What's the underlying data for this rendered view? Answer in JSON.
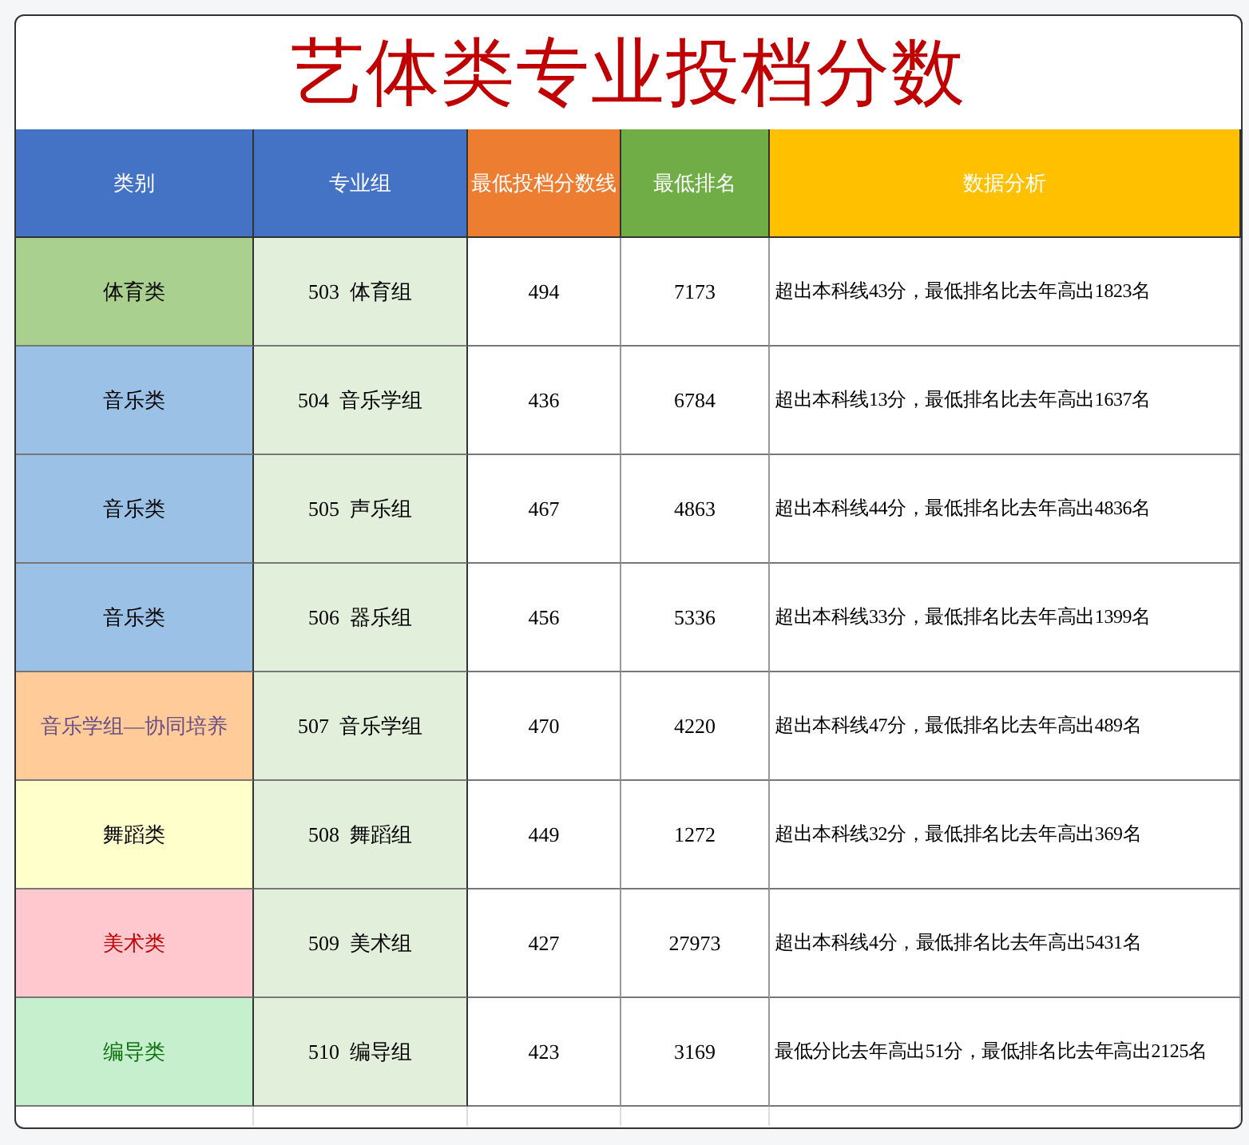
{
  "title": "艺体类专业投档分数",
  "columns": [
    {
      "label": "类别",
      "color": "#4472c4"
    },
    {
      "label": "专业组",
      "color": "#4472c4"
    },
    {
      "label": "最低投档分数线",
      "color": "#ed7d31"
    },
    {
      "label": "最低排名",
      "color": "#70ad47"
    },
    {
      "label": "数据分析",
      "color": "#ffc000"
    }
  ],
  "rows": [
    {
      "category": "体育类",
      "kind": "neutral",
      "color": "#a9d08e",
      "group": "503  体育组",
      "score": "494",
      "rank": "7173",
      "analysis": "超出本科线43分，最低排名比去年高出1823名"
    },
    {
      "category": "音乐类",
      "kind": "neutral",
      "color": "#9bc2e6",
      "group": "504  音乐学组",
      "score": "436",
      "rank": "6784",
      "analysis": "超出本科线13分，最低排名比去年高出1637名"
    },
    {
      "category": "音乐类",
      "kind": "neutral",
      "color": "#9bc2e6",
      "group": "505  声乐组",
      "score": "467",
      "rank": "4863",
      "analysis": "超出本科线44分，最低排名比去年高出4836名"
    },
    {
      "category": "音乐类",
      "kind": "neutral",
      "color": "#9bc2e6",
      "group": "506  器乐组",
      "score": "456",
      "rank": "5336",
      "analysis": "超出本科线33分，最低排名比去年高出1399名"
    },
    {
      "category": "音乐学组—协同培养",
      "kind": "muted",
      "color": "#ffcc99",
      "group": "507  音乐学组",
      "score": "470",
      "rank": "4220",
      "analysis": "超出本科线47分，最低排名比去年高出489名"
    },
    {
      "category": "舞蹈类",
      "kind": "neutral",
      "color": "#ffffcc",
      "group": "508  舞蹈组",
      "score": "449",
      "rank": "1272",
      "analysis": "超出本科线32分，最低排名比去年高出369名"
    },
    {
      "category": "美术类",
      "kind": "bad",
      "color": "#ffc7ce",
      "group": "509  美术组",
      "score": "427",
      "rank": "27973",
      "analysis": "超出本科线4分，最低排名比去年高出5431名"
    },
    {
      "category": "编导类",
      "kind": "good",
      "color": "#c6efce",
      "group": "510  编导组",
      "score": "423",
      "rank": "3169",
      "analysis": "最低分比去年高出51分，最低排名比去年高出2125名"
    }
  ]
}
